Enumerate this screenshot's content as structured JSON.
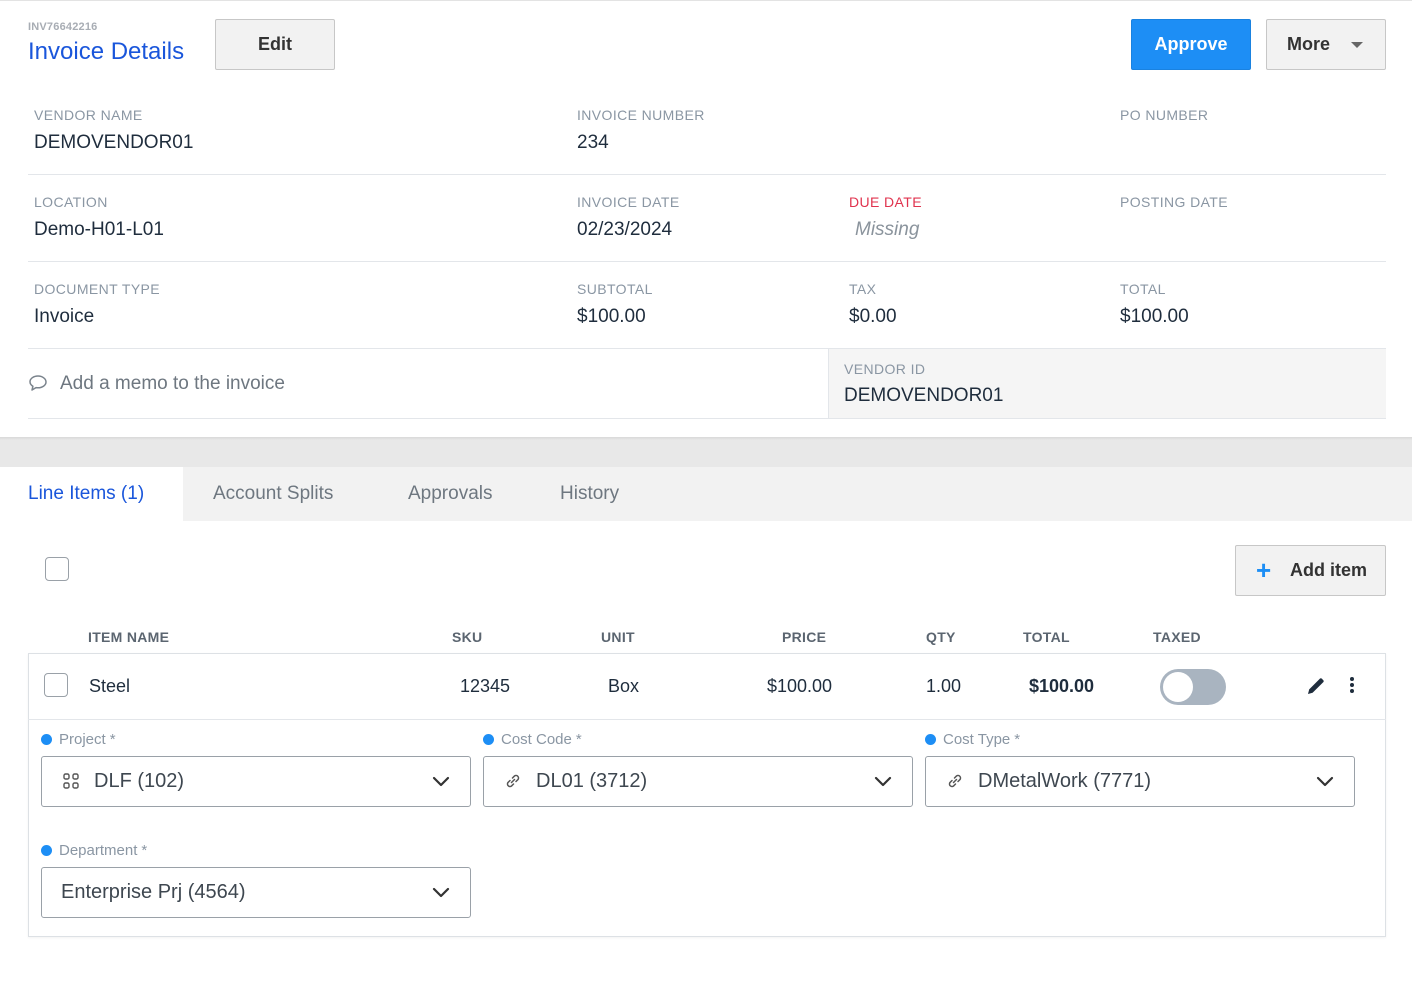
{
  "header": {
    "invoice_id": "INV76642216",
    "title": "Invoice Details",
    "edit_label": "Edit",
    "approve_label": "Approve",
    "more_label": "More"
  },
  "fields": {
    "vendor_name": {
      "label": "VENDOR NAME",
      "value": "DEMOVENDOR01"
    },
    "invoice_number": {
      "label": "INVOICE NUMBER",
      "value": "234"
    },
    "po_number": {
      "label": "PO NUMBER",
      "value": ""
    },
    "location": {
      "label": "LOCATION",
      "value": "Demo-H01-L01"
    },
    "invoice_date": {
      "label": "INVOICE DATE",
      "value": "02/23/2024"
    },
    "due_date": {
      "label": "DUE DATE",
      "value": "Missing"
    },
    "posting_date": {
      "label": "POSTING DATE",
      "value": ""
    },
    "document_type": {
      "label": "DOCUMENT TYPE",
      "value": "Invoice"
    },
    "subtotal": {
      "label": "SUBTOTAL",
      "value": "$100.00"
    },
    "tax": {
      "label": "TAX",
      "value": "$0.00"
    },
    "total": {
      "label": "TOTAL",
      "value": "$100.00"
    },
    "vendor_id": {
      "label": "VENDOR ID",
      "value": "DEMOVENDOR01"
    }
  },
  "memo": {
    "placeholder": "Add a memo to the invoice"
  },
  "tabs": [
    {
      "label": "Line Items (1)",
      "active": true
    },
    {
      "label": "Account Splits",
      "active": false
    },
    {
      "label": "Approvals",
      "active": false
    },
    {
      "label": "History",
      "active": false
    }
  ],
  "line_items": {
    "add_label": "Add item",
    "columns": [
      "ITEM NAME",
      "SKU",
      "UNIT",
      "PRICE",
      "QTY",
      "TOTAL",
      "TAXED"
    ],
    "rows": [
      {
        "item_name": "Steel",
        "sku": "12345",
        "unit": "Box",
        "price": "$100.00",
        "qty": "1.00",
        "total": "$100.00",
        "taxed": false
      }
    ],
    "dimensions": {
      "project": {
        "label": "Project",
        "required": "*",
        "value": "DLF (102)",
        "icon": "grid-icon"
      },
      "cost_code": {
        "label": "Cost Code",
        "required": "*",
        "value": "DL01 (3712)",
        "icon": "link-icon"
      },
      "cost_type": {
        "label": "Cost Type",
        "required": "*",
        "value": "DMetalWork (7771)",
        "icon": "link-icon"
      },
      "department": {
        "label": "Department",
        "required": "*",
        "value": "Enterprise Prj (4564)"
      }
    }
  },
  "colors": {
    "accent": "#1a56db",
    "primary_button": "#1d8ef5",
    "error_label": "#e0334e"
  }
}
